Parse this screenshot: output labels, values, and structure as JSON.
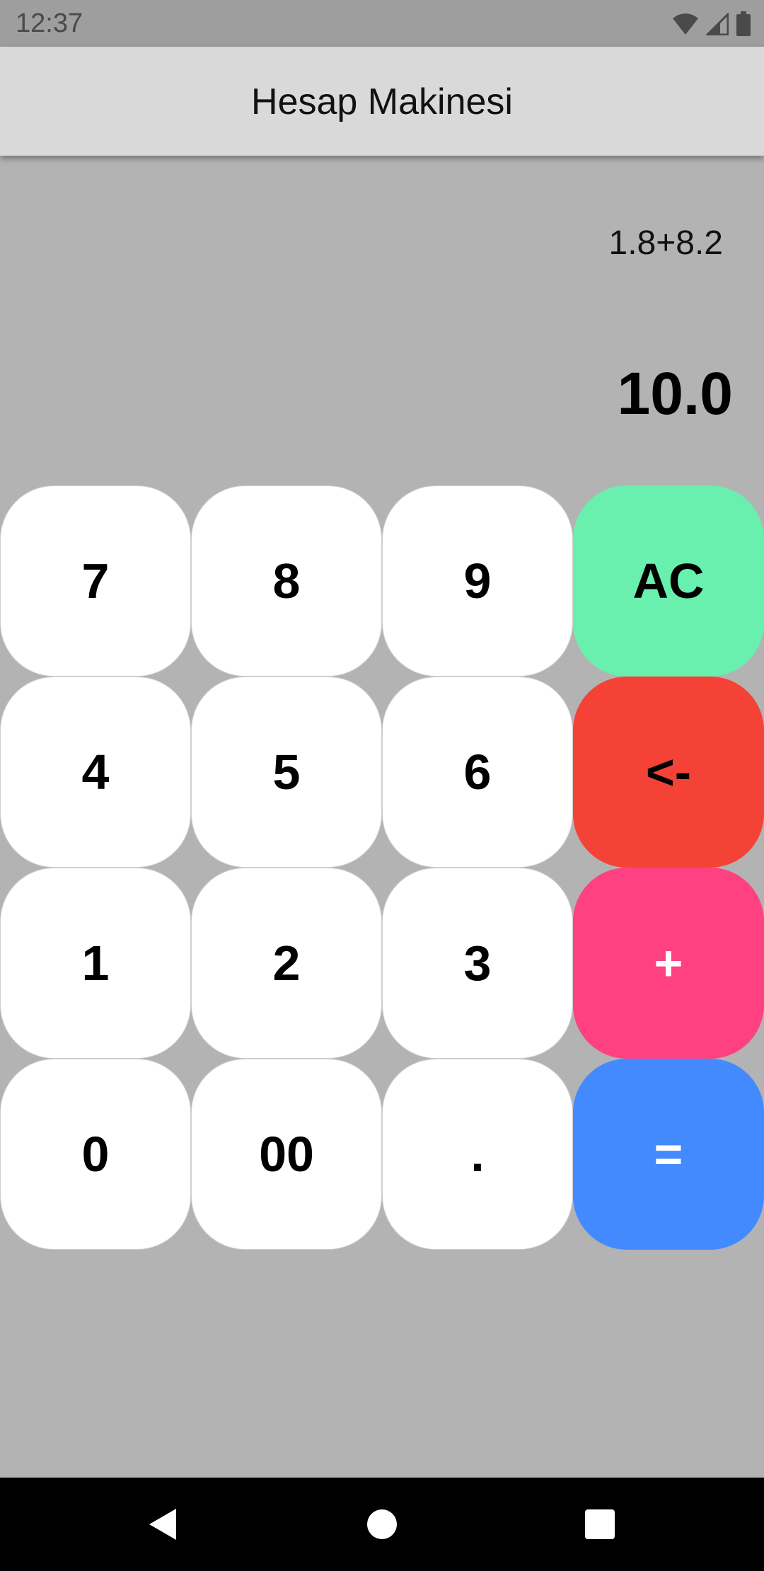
{
  "status_bar": {
    "time": "12:37",
    "icons": [
      "wifi-icon",
      "cell-signal-icon",
      "battery-icon"
    ]
  },
  "app_bar": {
    "title": "Hesap Makinesi"
  },
  "display": {
    "expression": "1.8+8.2",
    "result": "10.0"
  },
  "keypad": {
    "rows": [
      [
        {
          "label": "7",
          "bg": "#ffffff",
          "fg": "#000000"
        },
        {
          "label": "8",
          "bg": "#ffffff",
          "fg": "#000000"
        },
        {
          "label": "9",
          "bg": "#ffffff",
          "fg": "#000000"
        },
        {
          "label": "AC",
          "bg": "#69f0ae",
          "fg": "#000000"
        }
      ],
      [
        {
          "label": "4",
          "bg": "#ffffff",
          "fg": "#000000"
        },
        {
          "label": "5",
          "bg": "#ffffff",
          "fg": "#000000"
        },
        {
          "label": "6",
          "bg": "#ffffff",
          "fg": "#000000"
        },
        {
          "label": "<-",
          "bg": "#f44336",
          "fg": "#000000"
        }
      ],
      [
        {
          "label": "1",
          "bg": "#ffffff",
          "fg": "#000000"
        },
        {
          "label": "2",
          "bg": "#ffffff",
          "fg": "#000000"
        },
        {
          "label": "3",
          "bg": "#ffffff",
          "fg": "#000000"
        },
        {
          "label": "+",
          "bg": "#ff4081",
          "fg": "#ffffff"
        }
      ],
      [
        {
          "label": "0",
          "bg": "#ffffff",
          "fg": "#000000"
        },
        {
          "label": "00",
          "bg": "#ffffff",
          "fg": "#000000"
        },
        {
          "label": ".",
          "bg": "#ffffff",
          "fg": "#000000"
        },
        {
          "label": "=",
          "bg": "#448aff",
          "fg": "#ffffff"
        }
      ]
    ]
  },
  "nav_bar": {
    "buttons": [
      "back-icon",
      "home-icon",
      "recents-icon"
    ]
  },
  "colors": {
    "background": "#b3b3b3",
    "app_bar": "#d9d9d9",
    "status_bar": "#9e9e9e",
    "nav_bar": "#000000"
  }
}
